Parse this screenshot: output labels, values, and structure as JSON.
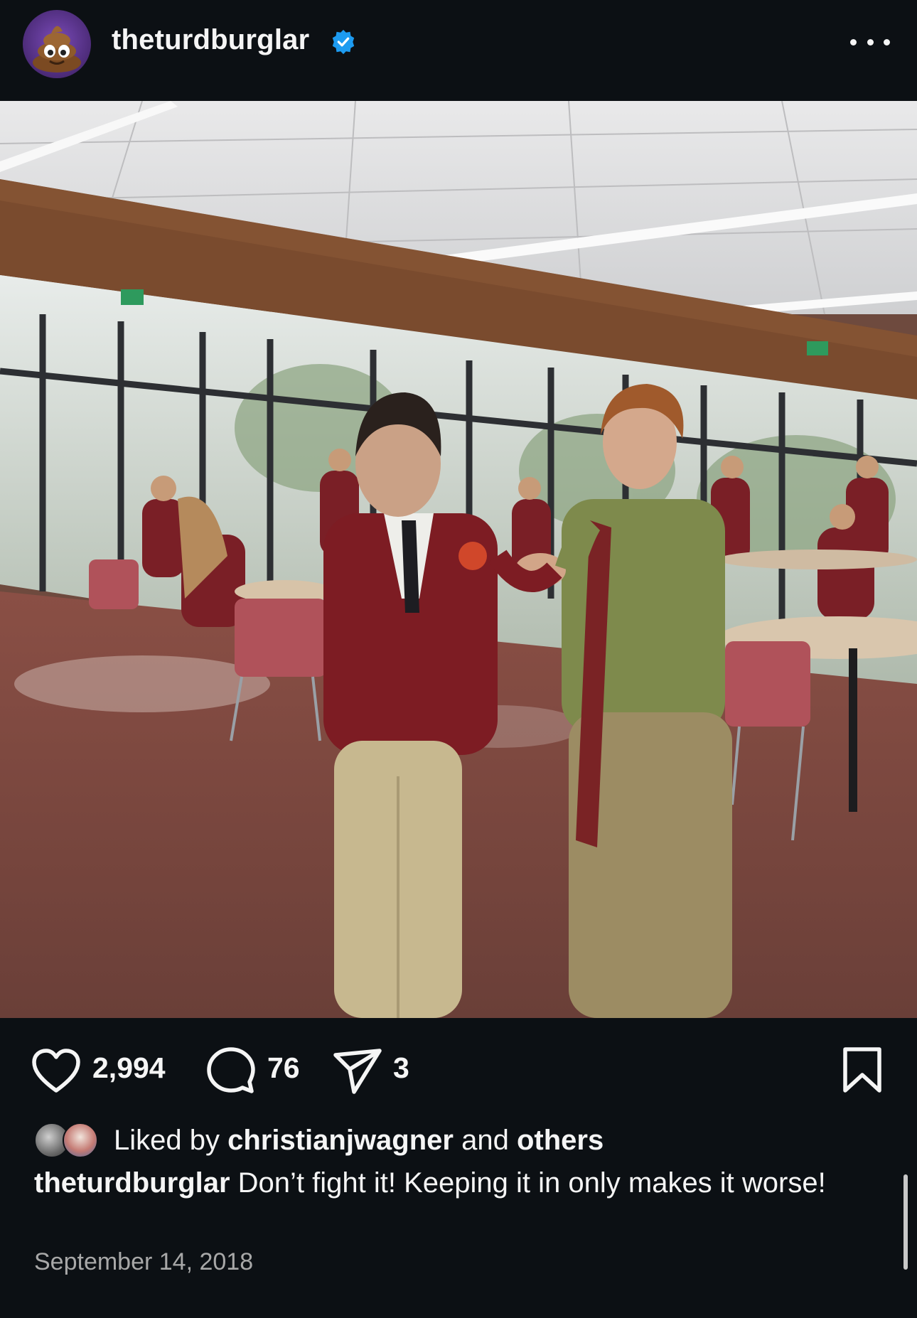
{
  "post": {
    "username": "theturdburglar",
    "verified": true,
    "avatar_icon": "poop-emoji-icon",
    "more_icon": "more-horizontal-icon"
  },
  "actions": {
    "likes": "2,994",
    "comments": "76",
    "shares": "3",
    "like_icon": "heart-icon",
    "comment_icon": "comment-bubble-icon",
    "share_icon": "paper-plane-icon",
    "save_icon": "bookmark-icon"
  },
  "liked_by": {
    "prefix": "Liked by",
    "user": "christianjwagner",
    "conjunction": "and",
    "others": "others"
  },
  "caption": {
    "username": "theturdburglar",
    "text": "Don’t fight it! Keeping it in only makes it worse!"
  },
  "date": "September 14, 2018",
  "colors": {
    "background": "#0c1014",
    "text": "#f5f5f5",
    "muted": "#a8a8a8",
    "verified": "#1d9bf0"
  }
}
